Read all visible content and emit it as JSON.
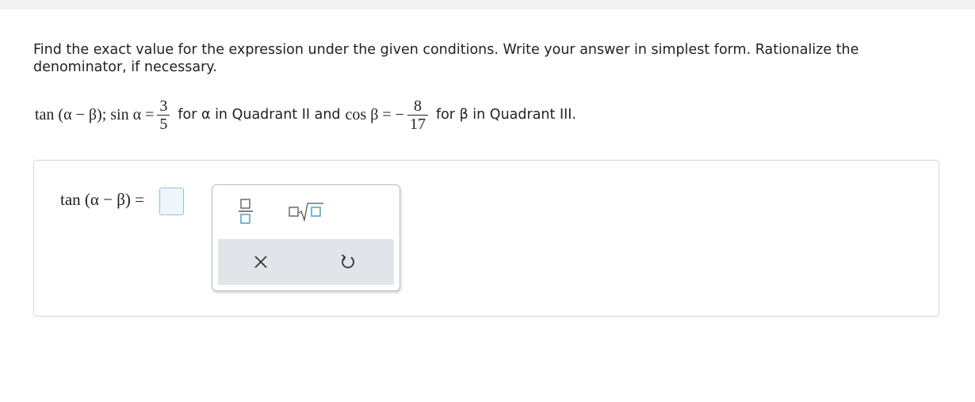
{
  "question": {
    "instructions": "Find the exact value for the expression under the given conditions. Write your answer in simplest form. Rationalize the denominator, if necessary.",
    "expression": "tan (α − β); sin α =",
    "sin_alpha": {
      "numerator": "3",
      "denominator": "5"
    },
    "alpha_condition": "for α in Quadrant II and",
    "cos_beta_label": "cos β = −",
    "cos_beta": {
      "numerator": "8",
      "denominator": "17"
    },
    "beta_condition": "for β in Quadrant III."
  },
  "answer": {
    "label": "tan (α − β) =",
    "value": ""
  },
  "palette": {
    "tools": [
      "fraction-icon",
      "square-root-icon"
    ],
    "actions": [
      "clear-icon",
      "undo-icon"
    ],
    "colors": {
      "template_box": "#5aa3d0",
      "action_bar": "#e1e5e9"
    }
  }
}
